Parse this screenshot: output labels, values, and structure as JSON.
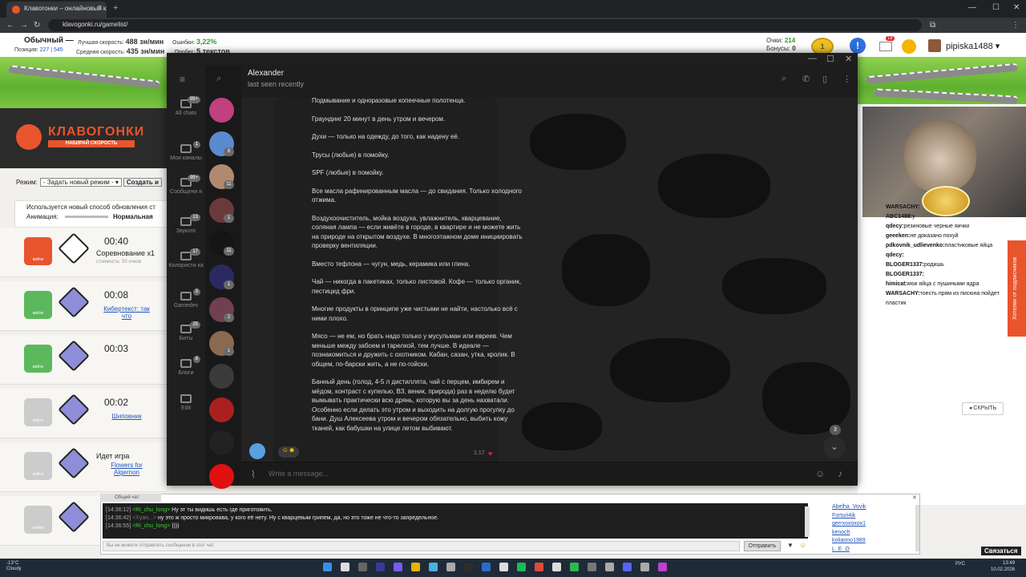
{
  "browser": {
    "tab_title": "Клавогонки – онлайновый кл...",
    "url": "klavogonki.ru/gamelist/"
  },
  "stats": {
    "mode": "Обычный —",
    "position_label": "Позиция:",
    "position_value": "227 | 545",
    "best_speed_label": "Лучшая скорость:",
    "best_speed": "488 зн/мин",
    "avg_speed_label": "Средняя скорость:",
    "avg_speed": "435 зн/мин",
    "errors_label": "Ошибки:",
    "errors": "3,22%",
    "mileage_label": "Пробег:",
    "mileage": "5 текстов",
    "points_label": "Очки:",
    "points": "214",
    "bonus_label": "Бонусы:",
    "bonus": "0",
    "level": "1",
    "mail_count": "18",
    "username": "pipiska1488"
  },
  "site": {
    "logo_title": "КЛАВОГОНКИ",
    "logo_subtitle": "НАБИРАЙ СКОРОСТЬ",
    "mode_label": "Режим:",
    "mode_value": "- Задать новый режим -",
    "create_label": "Создать и",
    "notice_line1": "Используется новый способ обновления ст",
    "notice_line2": "Анимация:",
    "animation_value": "Нормальная",
    "games": [
      {
        "btn": "войти",
        "time": "00:40",
        "name": "Соревнование x1",
        "sub": "стоимость: 50 очков",
        "color": "#e8552c"
      },
      {
        "btn": "войти",
        "time": "00:08",
        "link": "Кибертекст: так что",
        "color": "#5cb85c"
      },
      {
        "btn": "войти",
        "time": "00:03",
        "color": "#5cb85c"
      },
      {
        "btn": "войти",
        "time": "00:02",
        "link": "Шиповник",
        "color": "#cccccc"
      },
      {
        "btn": "войти",
        "name": "Идет игра",
        "link": "Flowers for Algernon",
        "color": "#cccccc"
      },
      {
        "btn": "войти",
        "color": "#cccccc"
      }
    ]
  },
  "stream": {
    "chat": [
      {
        "user": "WARSACHY:",
        "text": ""
      },
      {
        "user": "ABC1488:",
        "text": "у"
      },
      {
        "user": "qdecy:",
        "text": "резиновые черные яички"
      },
      {
        "user": "geeeken:",
        "text": "не доказано похуй"
      },
      {
        "user": "pdkovnik_udlievenko:",
        "text": "пластиковые яйца"
      },
      {
        "user": "qdecy:",
        "text": ""
      },
      {
        "user": "BLOGER1337:",
        "text": "родишь"
      },
      {
        "user": "BLOGER1337:",
        "text": ""
      },
      {
        "user": "himicat:",
        "text": "мои яйца с пушиными ядра"
      },
      {
        "user": "WARSACHY:",
        "text": "тоесть прям из писюна пойдет пластик"
      }
    ],
    "banner": "Хотелки от подписчиков",
    "hide_label": "СКРЫТЬ"
  },
  "telegram": {
    "contact_name": "Alexander",
    "contact_status": "last seen recently",
    "input_placeholder": "Write a message...",
    "message_time": "1:17",
    "unread_count": "3",
    "folders": [
      {
        "label": "All chats",
        "badge": "99+"
      },
      {
        "label": "Мои каналы",
        "badge": "1"
      },
      {
        "label": "Сообщени я",
        "badge": "99+"
      },
      {
        "label": "Звукотк",
        "badge": "13"
      },
      {
        "label": "Колористи ка",
        "badge": "17"
      },
      {
        "label": "Gamedev",
        "badge": "3"
      },
      {
        "label": "Биты",
        "badge": "25"
      },
      {
        "label": "Блоги",
        "badge": "8"
      },
      {
        "label": "Edit",
        "badge": ""
      }
    ],
    "chat_badges": [
      "",
      "8",
      "11",
      "1",
      "11",
      "1",
      "2",
      "1",
      "",
      "",
      "",
      ""
    ],
    "messages": [
      "Подмывание и одноразовые копеечные полотенца.",
      "Граундинг 20 минут в день утром и вечером.",
      "Духи — только на одежду, до того, как надену её.",
      "Трусы (любые) в помойку.",
      "SPF (любые) в помойку.",
      "Все масла рафинированным масла — до свидания. Только холодного отжима.",
      "Воздухоочиститель, мойка воздуха, увлажнитель, кварцевание, соляная лампа — если живёте в городе, в квартире и не можете жить на природе на открытом воздухе. В многоэтажном доме инициировать проверку вентиляции.",
      "Вместо тефлона — чугун, медь, керамика или глина.",
      "Чай — никогда в пакетиках, только листовой. Кофе — только органик, пестицид фри.",
      "Многие продукты в принципе уже чистыми не найти, настолько всё с ними плохо.",
      "Мясо — не ем, но брать надо только у мусульман или евреев. Чем меньше между забоем и тарелкой, тем лучше. В идеале — познакомиться и дружить с охотником. Кабан, сазан, утка, кролик. В общем, по-барски жить, а не по-гойски.",
      "Банный день (голод, 4-5 л дистиллята, чай с перцем, имбирем и мёдом, контраст с купелью, ВЗ, веник, природа) раз в неделю будет вымывать практически всю дрянь, которую вы за день нахватали. Особенно если делать это утром и выходить на долгую прогулку до бани. Душ Алексеева утром и вечером обязательно, выбить кожу тканей, как бабушки на улице летом выбивают."
    ]
  },
  "general_chat": {
    "tab": "Общий чат",
    "lines": [
      {
        "time": "[14:36:12]",
        "user": "<Ri_chu_long>",
        "text": "Ну эт ты видишь есть где приготовить."
      },
      {
        "time": "[14:36:42]",
        "user": "<Xyan...>",
        "text": "ну это ж просто микровава, у кого её нету. Ну с кварцевым грипем, да, но это тоже не что-то запредельное."
      },
      {
        "time": "[14:36:55]",
        "user": "<Ri_chu_long>",
        "text": "))))"
      }
    ],
    "users": [
      "Abelha_Vovik",
      "Forturi4ik",
      "gerrxoxoxox1",
      "kenoch",
      "kolianno1989",
      "L_E_O"
    ],
    "input_placeholder": "Вы не можете отправлять сообщения в этот чат",
    "send_label": "Отправить",
    "contact_label": "Связаться"
  },
  "taskbar": {
    "temp": "-13°C",
    "weather": "Cloudy",
    "lang": "РУС",
    "time": "13:49",
    "date": "10.02.2026"
  }
}
